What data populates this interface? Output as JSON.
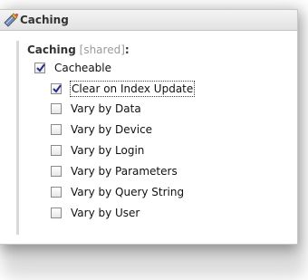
{
  "panel": {
    "title": "Caching",
    "icon": "caching-icon"
  },
  "section": {
    "title_main": "Caching",
    "title_scope": "[shared]",
    "title_colon": ":"
  },
  "options": [
    {
      "label": "Cacheable",
      "checked": true
    },
    {
      "label": "Clear on Index Update",
      "checked": true,
      "focused": true
    },
    {
      "label": "Vary by Data",
      "checked": false
    },
    {
      "label": "Vary by Device",
      "checked": false
    },
    {
      "label": "Vary by Login",
      "checked": false
    },
    {
      "label": "Vary by Parameters",
      "checked": false
    },
    {
      "label": "Vary by Query String",
      "checked": false
    },
    {
      "label": "Vary by User",
      "checked": false
    }
  ],
  "colors": {
    "check": "#2b2b8a",
    "header_bg": "#e8e8e8",
    "muted": "#9a9a9a"
  }
}
